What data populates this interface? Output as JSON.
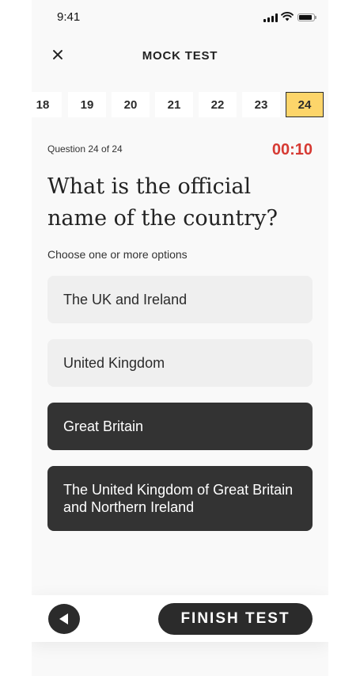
{
  "status_bar": {
    "time": "9:41"
  },
  "header": {
    "title": "MOCK TEST"
  },
  "question_nav": {
    "items": [
      "18",
      "19",
      "20",
      "21",
      "22",
      "23",
      "24"
    ],
    "active": "24"
  },
  "question": {
    "counter": "Question 24 of 24",
    "timer": "00:10",
    "text": "What is the official name of the country?",
    "instruction": "Choose one or more options"
  },
  "options": [
    {
      "label": "The UK and Ireland",
      "selected": false
    },
    {
      "label": "United Kingdom",
      "selected": false
    },
    {
      "label": "Great Britain",
      "selected": true
    },
    {
      "label": "The United Kingdom of Great Britain and Northern Ireland",
      "selected": true
    }
  ],
  "footer": {
    "finish_label": "FINISH TEST"
  },
  "colors": {
    "accent": "#fdd56a",
    "timer": "#d63a33",
    "dark": "#2b2b2b"
  }
}
